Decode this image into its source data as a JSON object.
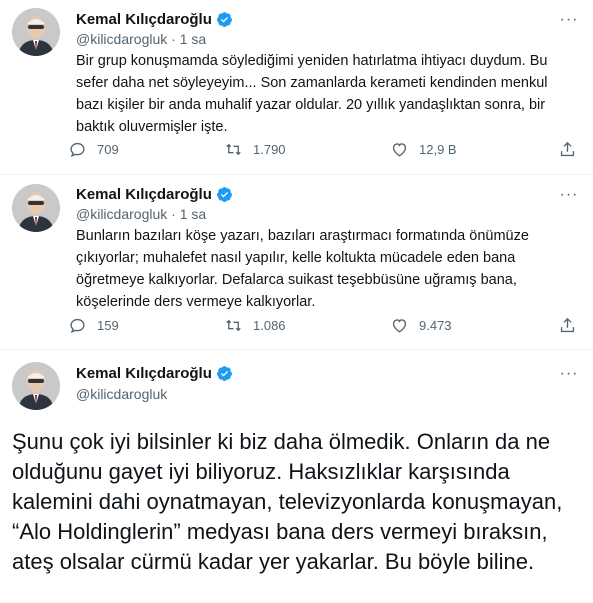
{
  "tweets": [
    {
      "author": "Kemal Kılıçdaroğlu",
      "handle": "@kilicdarogluk",
      "sep": "·",
      "time": "1 sa",
      "text": "Bir grup konuşmamda söylediğimi yeniden hatırlatma ihtiyacı duydum. Bu sefer daha net söyleyeyim... Son zamanlarda kerameti kendinden menkul bazı kişiler bir anda muhalif yazar oldular. 20 yıllık yandaşlıktan sonra, bir baktık oluvermişler işte.",
      "replies": "709",
      "retweets": "1.790",
      "likes": "12,9 B"
    },
    {
      "author": "Kemal Kılıçdaroğlu",
      "handle": "@kilicdarogluk",
      "sep": "·",
      "time": "1 sa",
      "text": "Bunların bazıları köşe yazarı, bazıları araştırmacı formatında önümüze çıkıyorlar; muhalefet nasıl yapılır, kelle koltukta mücadele eden bana öğretmeye kalkıyorlar. Defalarca suikast teşebbüsüne uğramış bana, köşelerinde ders vermeye kalkıyorlar.",
      "replies": "159",
      "retweets": "1.086",
      "likes": "9.473"
    },
    {
      "author": "Kemal Kılıçdaroğlu",
      "handle": "@kilicdarogluk",
      "text": "Şunu çok iyi bilsinler ki biz daha ölmedik. Onların da ne olduğunu gayet iyi biliyoruz. Haksızlıklar karşısında kalemini dahi oynatmayan, televizyonlarda konuşmayan, “Alo Holdinglerin” medyası bana ders vermeyi bıraksın, ateş olsalar cürmü kadar yer yakarlar. Bu böyle biline."
    }
  ],
  "icons": {
    "verified": "verified-badge-icon",
    "reply": "reply-icon",
    "retweet": "retweet-icon",
    "like": "like-icon",
    "share": "share-icon",
    "more": "more-icon"
  },
  "colors": {
    "verified": "#1d9bf0",
    "muted": "#536471",
    "text": "#0f1419",
    "divider": "#eff3f4"
  }
}
